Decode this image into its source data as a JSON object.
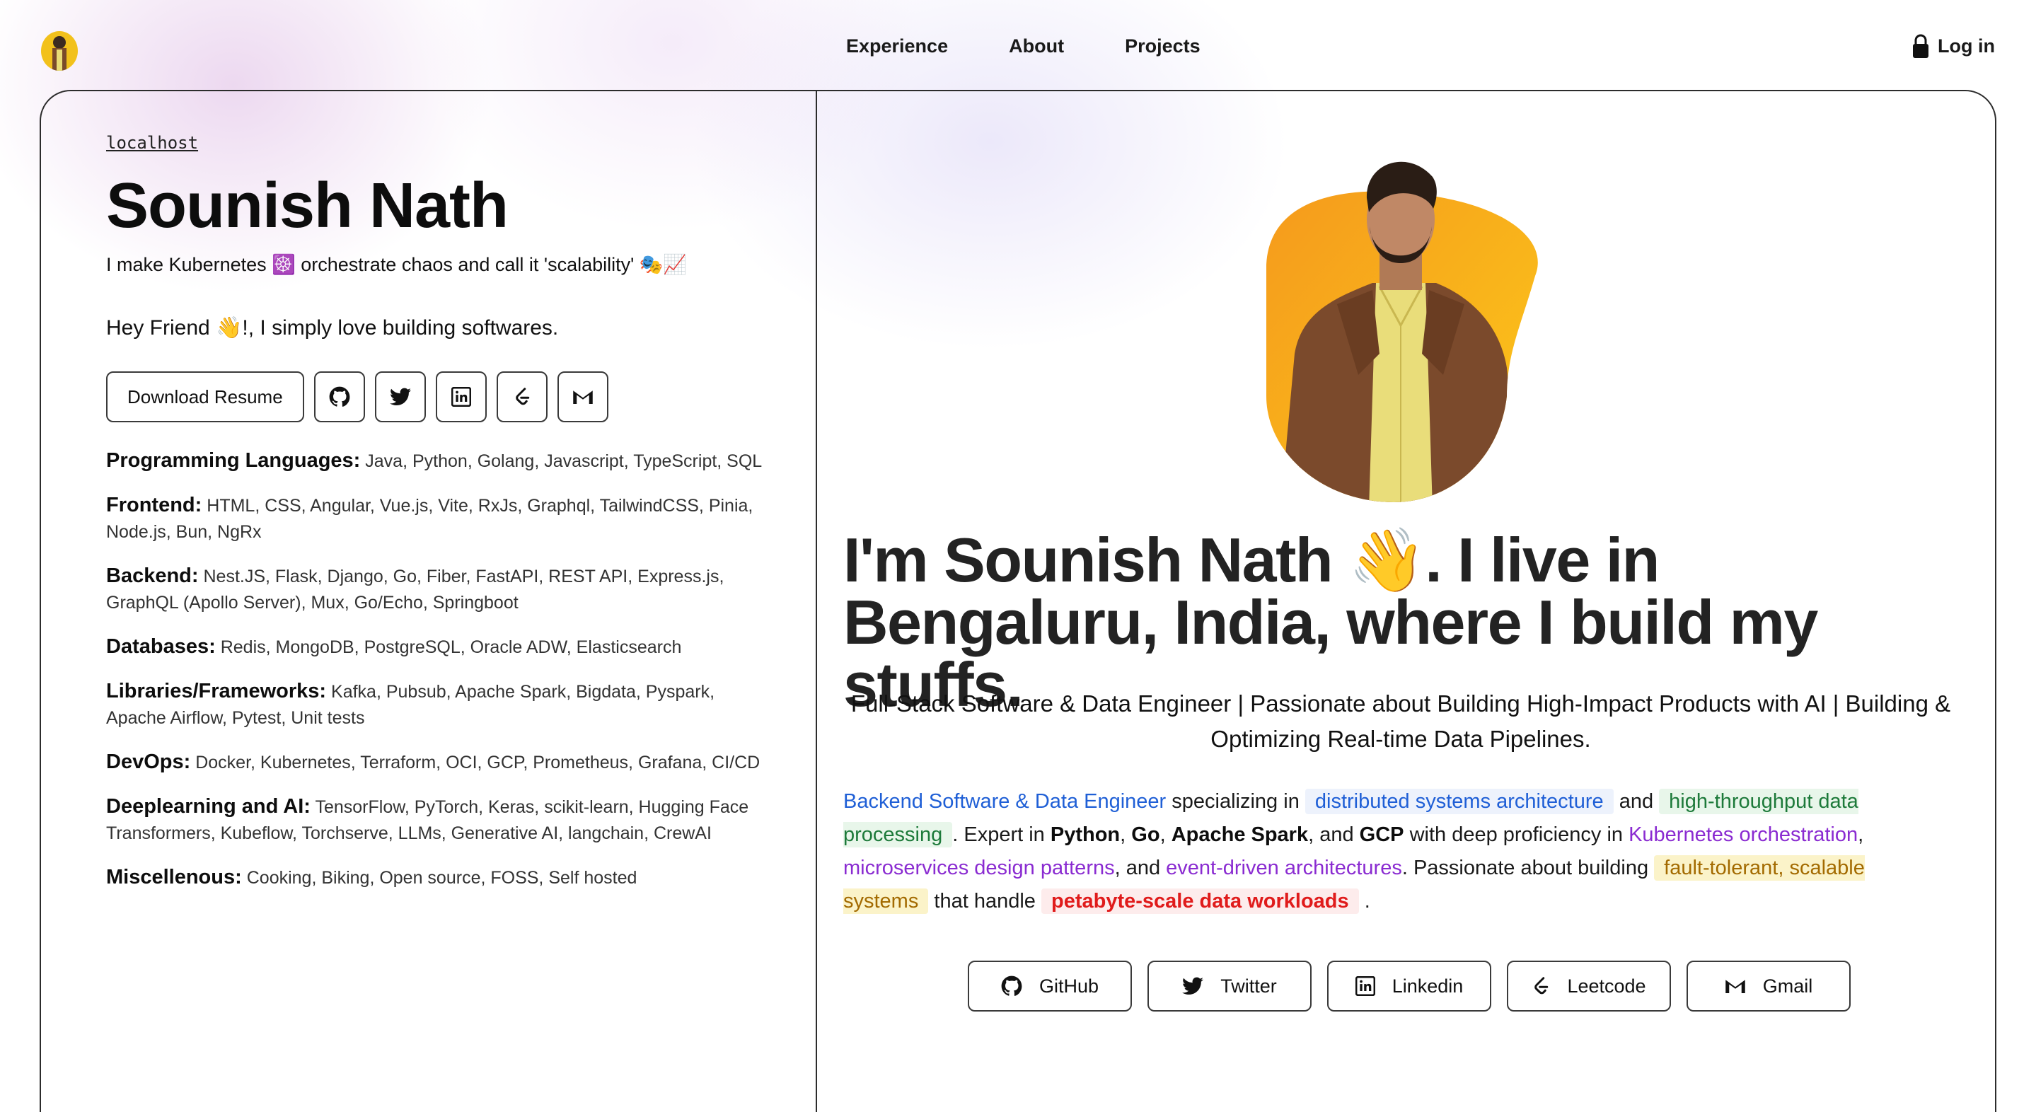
{
  "nav": {
    "items": [
      "Experience",
      "About",
      "Projects"
    ],
    "login_label": "Log in"
  },
  "profile": {
    "host": "localhost",
    "name": "Sounish Nath",
    "tagline": "I make Kubernetes ☸️ orchestrate chaos and call it 'scalability' 🎭📈",
    "greeting": "Hey Friend 👋!, I simply love building softwares.",
    "download_label": "Download Resume",
    "icon_buttons": [
      "github-icon",
      "twitter-icon",
      "linkedin-icon",
      "leetcode-icon",
      "gmail-icon"
    ]
  },
  "skills": [
    {
      "label": "Programming Languages:",
      "value": "Java, Python, Golang, Javascript, TypeScript, SQL"
    },
    {
      "label": "Frontend:",
      "value": "HTML, CSS, Angular, Vue.js, Vite, RxJs, Graphql, TailwindCSS, Pinia, Node.js, Bun, NgRx"
    },
    {
      "label": "Backend:",
      "value": "Nest.JS, Flask, Django, Go, Fiber, FastAPI, REST API, Express.js, GraphQL (Apollo Server), Mux, Go/Echo, Springboot"
    },
    {
      "label": "Databases:",
      "value": "Redis, MongoDB, PostgreSQL, Oracle ADW, Elasticsearch"
    },
    {
      "label": "Libraries/Frameworks:",
      "value": "Kafka, Pubsub, Apache Spark, Bigdata, Pyspark, Apache Airflow, Pytest, Unit tests"
    },
    {
      "label": "DevOps:",
      "value": "Docker, Kubernetes, Terraform, OCI, GCP, Prometheus, Grafana, CI/CD"
    },
    {
      "label": "Deeplearning and AI:",
      "value": "TensorFlow, PyTorch, Keras, scikit-learn, Hugging Face Transformers, Kubeflow, Torchserve, LLMs, Generative AI, langchain, CrewAI"
    },
    {
      "label": "Miscellenous:",
      "value": "Cooking, Biking, Open source, FOSS, Self hosted"
    }
  ],
  "hero": {
    "headline": "I'm Sounish Nath 👋. I live in Bengaluru, India, where I build my stuffs.",
    "role": "Full-Stack Software & Data Engineer | Passionate about Building High-Impact Products with AI | Building & Optimizing Real-time Data Pipelines."
  },
  "bio": {
    "p1": "Backend Software & Data Engineer",
    "p2": " specializing in ",
    "p3": "distributed systems architecture",
    "p4": " and ",
    "p5": "high-throughput data processing",
    "p6": ". Expert in ",
    "p7": "Python",
    "p8": ", ",
    "p9": "Go",
    "p10": ", ",
    "p11": "Apache Spark",
    "p12": ", and ",
    "p13": "GCP",
    "p14": " with deep proficiency in ",
    "p15": "Kubernetes orchestration",
    "p16": ", ",
    "p17": "microservices design patterns",
    "p18": ", and ",
    "p19": "event-driven architectures",
    "p20": ". Passionate about building ",
    "p21": "fault-tolerant, scalable systems",
    "p22": " that handle ",
    "p23": "petabyte-scale data workloads",
    "p24": " ."
  },
  "social": [
    {
      "label": "GitHub",
      "icon": "github-icon"
    },
    {
      "label": "Twitter",
      "icon": "twitter-icon"
    },
    {
      "label": "Linkedin",
      "icon": "linkedin-icon"
    },
    {
      "label": "Leetcode",
      "icon": "leetcode-icon"
    },
    {
      "label": "Gmail",
      "icon": "gmail-icon"
    }
  ],
  "colors": {
    "accent_blue": "#1f5fd6",
    "accent_green": "#1d7a3a",
    "accent_purple": "#8a2bd1",
    "accent_yellow": "#a36a00",
    "accent_red": "#e01b1b",
    "blob": "#f7b318"
  }
}
